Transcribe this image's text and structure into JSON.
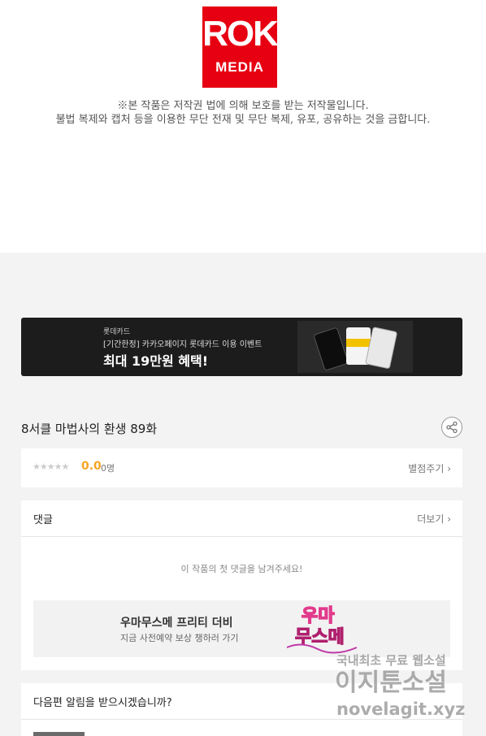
{
  "logo": {
    "line1": "ROK",
    "line2": "MEDIA"
  },
  "copyright": {
    "line1": "※본 작품은 저작권 법에 의해 보호를 받는 저작물입니다.",
    "line2": "불법 복제와 캡처 등을 이용한 무단 전재 및 무단 복제, 유포, 공유하는 것을 금합니다."
  },
  "banner": {
    "brand": "롯데카드",
    "subtitle": "[기간한정] 카카오페이지 롯데카드 이용 이벤트",
    "headline": "최대 19만원 혜택!"
  },
  "episode": {
    "title": "8서클 마법사의 환생 89화",
    "share_icon": "share-icon"
  },
  "rating": {
    "stars": "★★★★★",
    "score": "0.0",
    "count": "0명",
    "rate_label": "별점주기 ›"
  },
  "comments": {
    "title": "댓글",
    "more_label": "더보기 ›",
    "empty_text": "이 작품의 첫 댓글을 남겨주세요!",
    "promo": {
      "title": "우마무스메 프리티 더비",
      "subtitle": "지금 사전예약 보상 챙하러 가기",
      "art_text_1": "우마",
      "art_text_2": "무스메"
    }
  },
  "next_alert": {
    "title": "다음편 알림을 받으시겠습니까?"
  },
  "watermark": {
    "line1": "국내최초 무료 웹소설",
    "line2": "이지툰소설",
    "line3": "novelagit.xyz"
  },
  "colors": {
    "brand_red": "#e60012",
    "score": "#f5a623",
    "banner_bg": "#1c1c1c",
    "page_bg": "#f3f3f3"
  }
}
